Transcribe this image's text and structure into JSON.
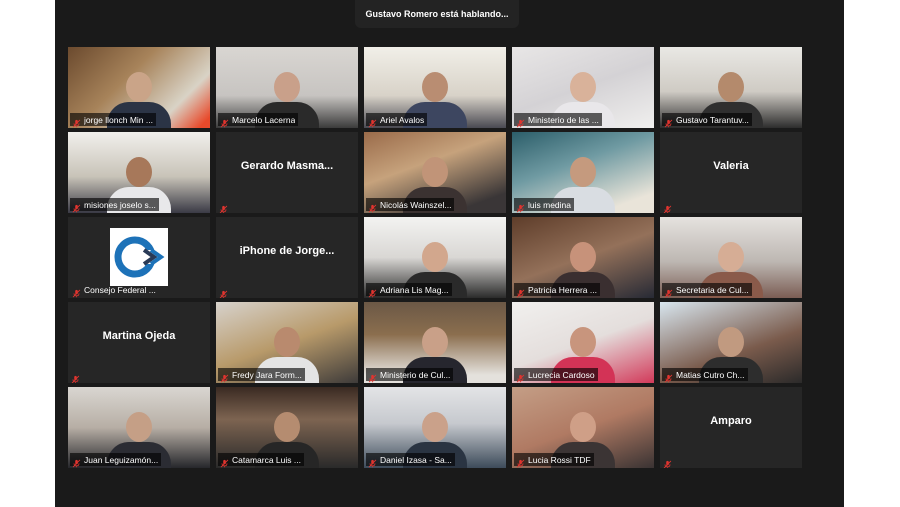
{
  "banner": {
    "text": "Gustavo Romero está hablando..."
  },
  "participants": [
    {
      "name": "jorge llonch Min ...",
      "video": true,
      "bg": "bg1",
      "skin": "#caa488",
      "shirt": "#2b3445"
    },
    {
      "name": "Marcelo Lacerna",
      "video": true,
      "bg": "bg2",
      "skin": "#c9a08a",
      "shirt": "#2a2a2a"
    },
    {
      "name": "Ariel Avalos",
      "video": true,
      "bg": "bg3",
      "skin": "#b98d72",
      "shirt": "#3d4660"
    },
    {
      "name": "Ministerio de las ...",
      "video": true,
      "bg": "bg4",
      "skin": "#d9b29a",
      "shirt": "#e9e7ea"
    },
    {
      "name": "Gustavo Tarantuv...",
      "video": true,
      "bg": "bg5",
      "skin": "#b48a6c",
      "shirt": "#2f2f2f"
    },
    {
      "name": "misiones joselo s...",
      "video": true,
      "bg": "bg6",
      "skin": "#a7785a",
      "shirt": "#e8e8ea"
    },
    {
      "name": "Gerardo  Masma...",
      "video": false
    },
    {
      "name": "Nicolás Wainszel...",
      "video": true,
      "bg": "bg7",
      "skin": "#c19478",
      "shirt": "#3b3231"
    },
    {
      "name": "luis medina",
      "video": true,
      "bg": "bg8",
      "skin": "#c59a7e",
      "shirt": "#d9dde2"
    },
    {
      "name": "Valeria",
      "video": false
    },
    {
      "name": "Consejo Federal ...",
      "video": false,
      "logo": true
    },
    {
      "name": "iPhone de Jorge...",
      "video": false
    },
    {
      "name": "Adriana Lis  Mag...",
      "video": true,
      "bg": "bg9",
      "skin": "#d2a78d",
      "shirt": "#2a2a2a"
    },
    {
      "name": "Patricia Herrera ...",
      "video": true,
      "bg": "bg10",
      "skin": "#c7927a",
      "shirt": "#3a2f30"
    },
    {
      "name": "Secretaria de Cul...",
      "video": true,
      "bg": "bg11",
      "skin": "#d6ad95",
      "shirt": "#8a5a4a"
    },
    {
      "name": "Martina Ojeda",
      "video": false
    },
    {
      "name": "Fredy Jara Form...",
      "video": true,
      "bg": "bg12",
      "skin": "#b98a6e",
      "shirt": "#e4e4e4"
    },
    {
      "name": "Ministerio de Cul...",
      "video": true,
      "bg": "bg13",
      "skin": "#c9a088",
      "shirt": "#26262e"
    },
    {
      "name": "Lucrecia Cardoso",
      "video": true,
      "bg": "bg15",
      "skin": "#c8957d",
      "shirt": "#d33356"
    },
    {
      "name": "Matias Cutro Ch...",
      "video": true,
      "bg": "bg16",
      "skin": "#c19a80",
      "shirt": "#2d2d2d"
    },
    {
      "name": "Juan Leguizamón...",
      "video": true,
      "bg": "bg17",
      "skin": "#c59f86",
      "shirt": "#2b2c33"
    },
    {
      "name": "Catamarca Luis ...",
      "video": true,
      "bg": "bg18",
      "skin": "#b58c70",
      "shirt": "#262626"
    },
    {
      "name": "Daniel Izasa - Sa...",
      "video": true,
      "bg": "bg19",
      "skin": "#caa18a",
      "shirt": "#2a3442"
    },
    {
      "name": "Lucia Rossi TDF",
      "video": true,
      "bg": "bg20",
      "skin": "#cf9f87",
      "shirt": "#3b3434"
    },
    {
      "name": "Amparo",
      "video": false
    }
  ],
  "colors": {
    "muted_icon": "#e0342f",
    "logo_blue": "#1d72b8",
    "logo_dark": "#2a3a56"
  },
  "icons": {
    "mic": "muted-microphone-icon",
    "logo": "consejo-federal-logo"
  }
}
